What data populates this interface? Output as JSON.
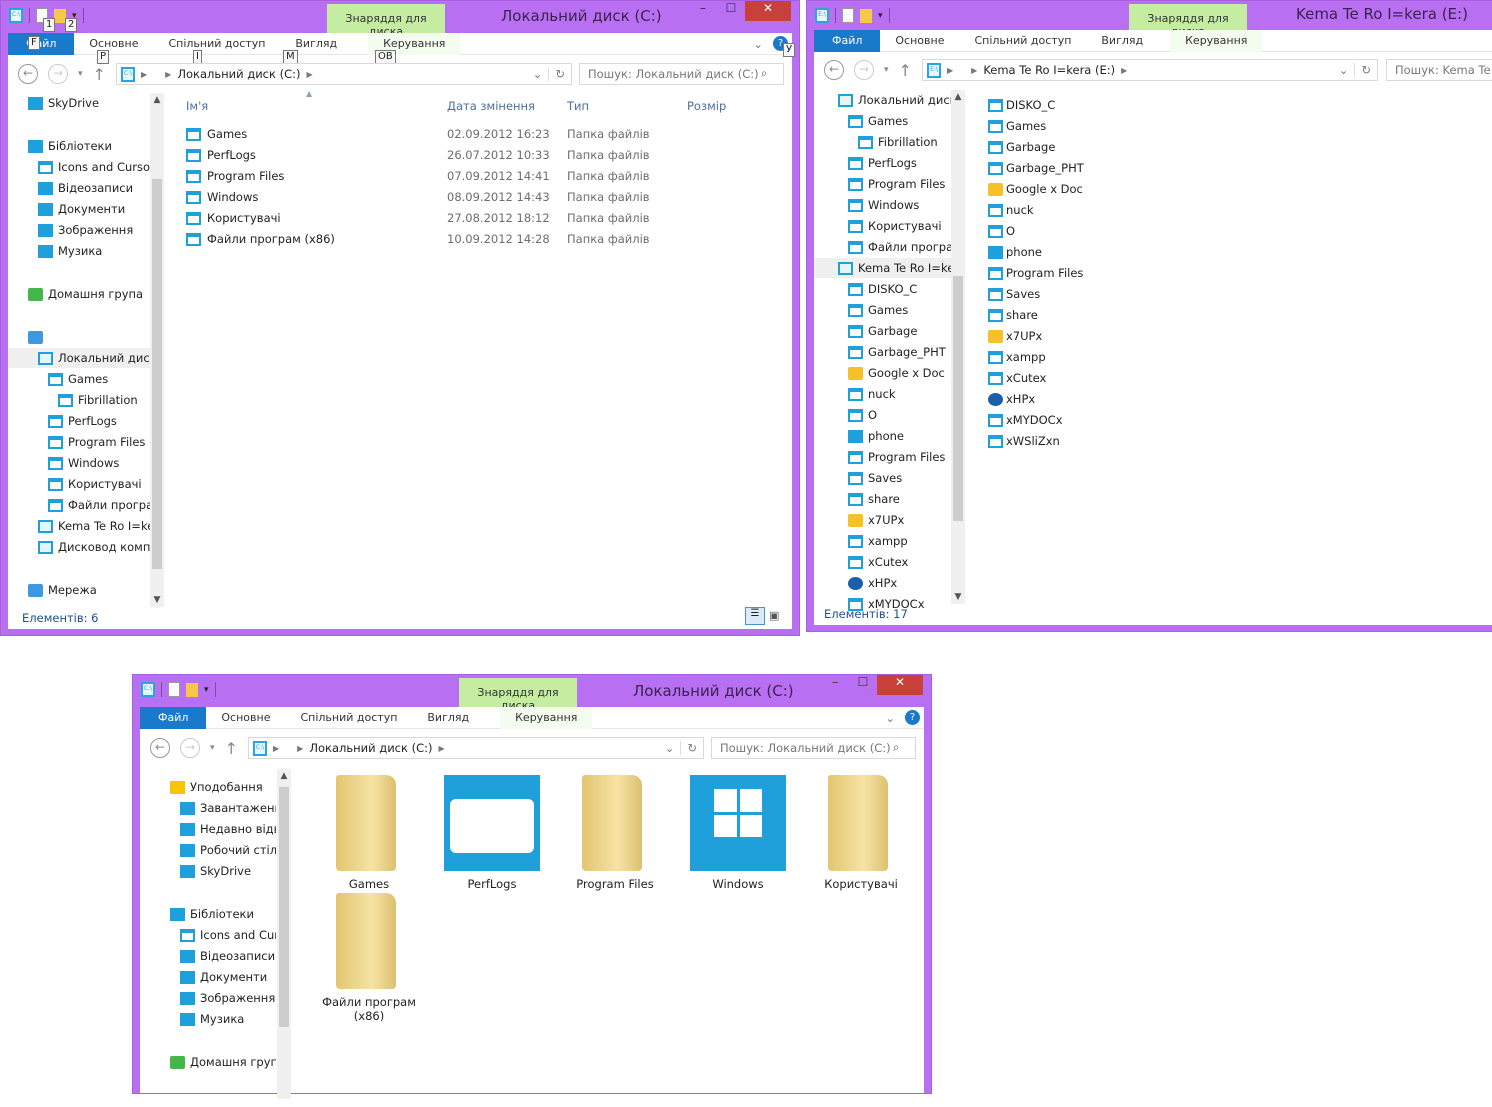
{
  "ribbon_tabs": [
    "Файл",
    "Основне",
    "Спільний доступ",
    "Вигляд",
    "Керування"
  ],
  "context_tab": "Знаряддя для диска",
  "keytips": {
    "qa1": "1",
    "qa2": "2",
    "file": "F",
    "home": "P",
    "share": "I",
    "view": "M",
    "manage": "OB",
    "help": "У"
  },
  "win1": {
    "title": "Локальний диск (C:)",
    "address": "Локальний диск (C:)",
    "search_placeholder": "Пошук: Локальний диск (C:)",
    "tree": [
      {
        "label": "SkyDrive",
        "icon": "lib",
        "lvl": 0
      },
      {
        "label": "Бібліотеки",
        "icon": "lib",
        "lvl": 0,
        "gap": 1
      },
      {
        "label": "Icons and Cursor",
        "icon": "folder",
        "lvl": 1
      },
      {
        "label": "Відеозаписи",
        "icon": "lib",
        "lvl": 1
      },
      {
        "label": "Документи",
        "icon": "lib",
        "lvl": 1
      },
      {
        "label": "Зображення",
        "icon": "lib",
        "lvl": 1
      },
      {
        "label": "Музика",
        "icon": "music",
        "lvl": 1
      },
      {
        "label": "Домашня група",
        "icon": "home",
        "lvl": 0,
        "gap": 1
      },
      {
        "label": "",
        "icon": "net",
        "lvl": 0,
        "gap": 1
      },
      {
        "label": "Локальний диск",
        "icon": "drive",
        "lvl": 1,
        "sel": 1
      },
      {
        "label": "Games",
        "icon": "folder",
        "lvl": 2
      },
      {
        "label": "Fibrillation",
        "icon": "folder",
        "lvl": 3
      },
      {
        "label": "PerfLogs",
        "icon": "folder",
        "lvl": 2
      },
      {
        "label": "Program Files",
        "icon": "folder",
        "lvl": 2
      },
      {
        "label": "Windows",
        "icon": "folder",
        "lvl": 2
      },
      {
        "label": "Користувачі",
        "icon": "folder",
        "lvl": 2
      },
      {
        "label": "Файли програ",
        "icon": "folder",
        "lvl": 2
      },
      {
        "label": "Kema Te Ro I=ke",
        "icon": "drive",
        "lvl": 1
      },
      {
        "label": "Дисковод компа",
        "icon": "drive",
        "lvl": 1
      },
      {
        "label": "Мережа",
        "icon": "net",
        "lvl": 0,
        "gap": 1
      }
    ],
    "columns": [
      "Ім'я",
      "Дата змінення",
      "Тип",
      "Розмір"
    ],
    "files": [
      {
        "name": "Games",
        "date": "02.09.2012 16:23",
        "type": "Папка файлів"
      },
      {
        "name": "PerfLogs",
        "date": "26.07.2012 10:33",
        "type": "Папка файлів"
      },
      {
        "name": "Program Files",
        "date": "07.09.2012 14:41",
        "type": "Папка файлів"
      },
      {
        "name": "Windows",
        "date": "08.09.2012 14:43",
        "type": "Папка файлів"
      },
      {
        "name": "Користувачі",
        "date": "27.08.2012 18:12",
        "type": "Папка файлів"
      },
      {
        "name": "Файли програм (x86)",
        "date": "10.09.2012 14:28",
        "type": "Папка файлів"
      }
    ],
    "status": "Елементів: 6"
  },
  "win2": {
    "title": "Kema Te Ro I=kera (E:)",
    "address": "Kema Te Ro I=kera (E:)",
    "search_placeholder": "Пошук: Kema Te Ro",
    "tree": [
      {
        "label": "Локальний диск",
        "icon": "drive",
        "lvl": 0
      },
      {
        "label": "Games",
        "icon": "folder",
        "lvl": 1
      },
      {
        "label": "Fibrillation",
        "icon": "folder",
        "lvl": 2
      },
      {
        "label": "PerfLogs",
        "icon": "folder",
        "lvl": 1
      },
      {
        "label": "Program Files",
        "icon": "folder",
        "lvl": 1
      },
      {
        "label": "Windows",
        "icon": "folder",
        "lvl": 1
      },
      {
        "label": "Користувачі",
        "icon": "folder",
        "lvl": 1
      },
      {
        "label": "Файли програ",
        "icon": "folder",
        "lvl": 1
      },
      {
        "label": "Kema Te Ro I=ke",
        "icon": "drive",
        "lvl": 0,
        "sel": 1
      },
      {
        "label": "DISKO_C",
        "icon": "folder",
        "lvl": 1
      },
      {
        "label": "Games",
        "icon": "folder",
        "lvl": 1
      },
      {
        "label": "Garbage",
        "icon": "folder",
        "lvl": 1
      },
      {
        "label": "Garbage_PHT",
        "icon": "folder",
        "lvl": 1
      },
      {
        "label": "Google x Doc",
        "icon": "yel",
        "lvl": 1
      },
      {
        "label": "nuck",
        "icon": "folder",
        "lvl": 1
      },
      {
        "label": "O",
        "icon": "folder",
        "lvl": 1
      },
      {
        "label": "phone",
        "icon": "music",
        "lvl": 1
      },
      {
        "label": "Program Files",
        "icon": "folder",
        "lvl": 1
      },
      {
        "label": "Saves",
        "icon": "folder",
        "lvl": 1
      },
      {
        "label": "share",
        "icon": "folder",
        "lvl": 1
      },
      {
        "label": "x7UPx",
        "icon": "yel",
        "lvl": 1
      },
      {
        "label": "xampp",
        "icon": "folder",
        "lvl": 1
      },
      {
        "label": "xCutex",
        "icon": "folder",
        "lvl": 1
      },
      {
        "label": "xHPx",
        "icon": "hp",
        "lvl": 1
      },
      {
        "label": "xMYDOCx",
        "icon": "folder",
        "lvl": 1
      }
    ],
    "files": [
      {
        "name": "DISKO_C",
        "icon": "folder"
      },
      {
        "name": "Games",
        "icon": "folder"
      },
      {
        "name": "Garbage",
        "icon": "folder"
      },
      {
        "name": "Garbage_PHT",
        "icon": "folder"
      },
      {
        "name": "Google x Doc",
        "icon": "yel"
      },
      {
        "name": "nuck",
        "icon": "folder"
      },
      {
        "name": "O",
        "icon": "folder"
      },
      {
        "name": "phone",
        "icon": "music"
      },
      {
        "name": "Program Files",
        "icon": "folder"
      },
      {
        "name": "Saves",
        "icon": "folder"
      },
      {
        "name": "share",
        "icon": "folder"
      },
      {
        "name": "x7UPx",
        "icon": "yel"
      },
      {
        "name": "xampp",
        "icon": "folder"
      },
      {
        "name": "xCutex",
        "icon": "folder"
      },
      {
        "name": "xHPx",
        "icon": "hp"
      },
      {
        "name": "xMYDOCx",
        "icon": "folder"
      },
      {
        "name": "xWSliZxn",
        "icon": "folder"
      }
    ],
    "status": "Елементів: 17"
  },
  "win3": {
    "title": "Локальний диск (C:)",
    "address": "Локальний диск (C:)",
    "search_placeholder": "Пошук: Локальний диск (C:)",
    "tree": [
      {
        "label": "Уподобання",
        "icon": "star",
        "lvl": 0
      },
      {
        "label": "Завантаження",
        "icon": "lib",
        "lvl": 1
      },
      {
        "label": "Недавно відвіда",
        "icon": "lib",
        "lvl": 1
      },
      {
        "label": "Робочий стіл",
        "icon": "lib",
        "lvl": 1
      },
      {
        "label": "SkyDrive",
        "icon": "lib",
        "lvl": 1
      },
      {
        "label": "Бібліотеки",
        "icon": "lib",
        "lvl": 0,
        "gap": 1
      },
      {
        "label": "Icons and Curso",
        "icon": "folder",
        "lvl": 1
      },
      {
        "label": "Відеозаписи",
        "icon": "lib",
        "lvl": 1
      },
      {
        "label": "Документи",
        "icon": "lib",
        "lvl": 1
      },
      {
        "label": "Зображення",
        "icon": "lib",
        "lvl": 1
      },
      {
        "label": "Музика",
        "icon": "music",
        "lvl": 1
      },
      {
        "label": "Домашня група",
        "icon": "home",
        "lvl": 0,
        "gap": 1
      }
    ],
    "items": [
      {
        "name": "Games",
        "style": "manila"
      },
      {
        "name": "PerfLogs",
        "style": "tile"
      },
      {
        "name": "Program Files",
        "style": "manila"
      },
      {
        "name": "Windows",
        "style": "tilewin"
      },
      {
        "name": "Користувачі",
        "style": "manila"
      },
      {
        "name": "Файли програм (x86)",
        "style": "manila"
      }
    ]
  }
}
